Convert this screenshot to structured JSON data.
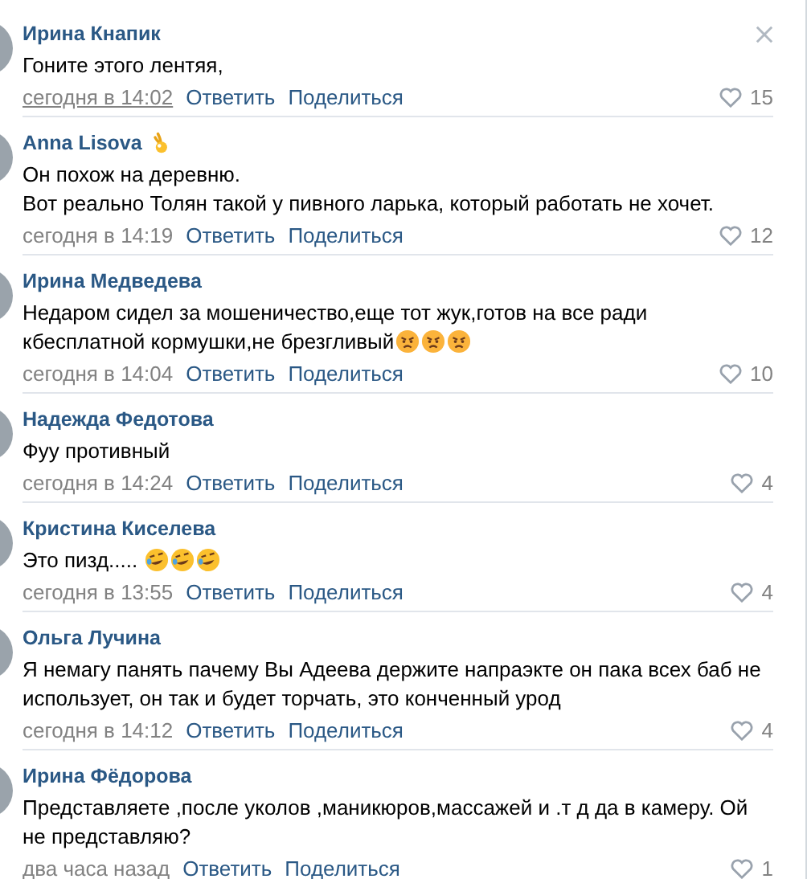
{
  "comments": [
    {
      "author": "Ирина Кнапик",
      "text": [
        [
          {
            "kind": "text",
            "value": "Гоните этого лентяя,"
          }
        ]
      ],
      "time": "сегодня в 14:02",
      "time_hovered": true,
      "reply": "Ответить",
      "share": "Поделиться",
      "likes": "15",
      "closable": true
    },
    {
      "author": "Anna Lisova",
      "author_badge": {
        "kind": "ok_hand"
      },
      "text": [
        [
          {
            "kind": "text",
            "value": "Он похож на деревню."
          }
        ],
        [
          {
            "kind": "text",
            "value": "Вот реально Толян такой у пивного ларька, который работать не хочет."
          }
        ]
      ],
      "time": "сегодня в 14:19",
      "time_hovered": false,
      "reply": "Ответить",
      "share": "Поделиться",
      "likes": "12",
      "closable": false
    },
    {
      "author": "Ирина Медведева",
      "text": [
        [
          {
            "kind": "text",
            "value": "Недаром сидел за мошеничество,еще тот жук,готов на все ради кбесплатной кормушки,не брезгливый"
          },
          {
            "kind": "angry_face"
          },
          {
            "kind": "angry_face"
          },
          {
            "kind": "angry_face"
          }
        ]
      ],
      "time": "сегодня в 14:04",
      "time_hovered": false,
      "reply": "Ответить",
      "share": "Поделиться",
      "likes": "10",
      "closable": false
    },
    {
      "author": "Надежда Федотова",
      "text": [
        [
          {
            "kind": "text",
            "value": "Фуу противный"
          }
        ]
      ],
      "time": "сегодня в 14:24",
      "time_hovered": false,
      "reply": "Ответить",
      "share": "Поделиться",
      "likes": "4",
      "closable": false
    },
    {
      "author": "Кристина Киселева",
      "text": [
        [
          {
            "kind": "text",
            "value": "Это пизд..... "
          },
          {
            "kind": "laughing_face"
          },
          {
            "kind": "laughing_face"
          },
          {
            "kind": "laughing_face"
          }
        ]
      ],
      "time": "сегодня в 13:55",
      "time_hovered": false,
      "reply": "Ответить",
      "share": "Поделиться",
      "likes": "4",
      "closable": false
    },
    {
      "author": "Ольга Лучина",
      "text": [
        [
          {
            "kind": "text",
            "value": "Я немагу панять пачему Вы Адеева держите напраэкте он пака всех баб не использует, он так и будет торчать, это конченный урод"
          }
        ]
      ],
      "time": "сегодня в 14:12",
      "time_hovered": false,
      "reply": "Ответить",
      "share": "Поделиться",
      "likes": "4",
      "closable": false
    },
    {
      "author": "Ирина Фёдорова",
      "text": [
        [
          {
            "kind": "text",
            "value": "Представляете ,после уколов ,маникюров,массажей и .т д да в камеру. Ой не представляю?"
          }
        ]
      ],
      "time": "два часа назад",
      "time_hovered": false,
      "reply": "Ответить",
      "share": "Поделиться",
      "likes": "1",
      "closable": false
    }
  ]
}
